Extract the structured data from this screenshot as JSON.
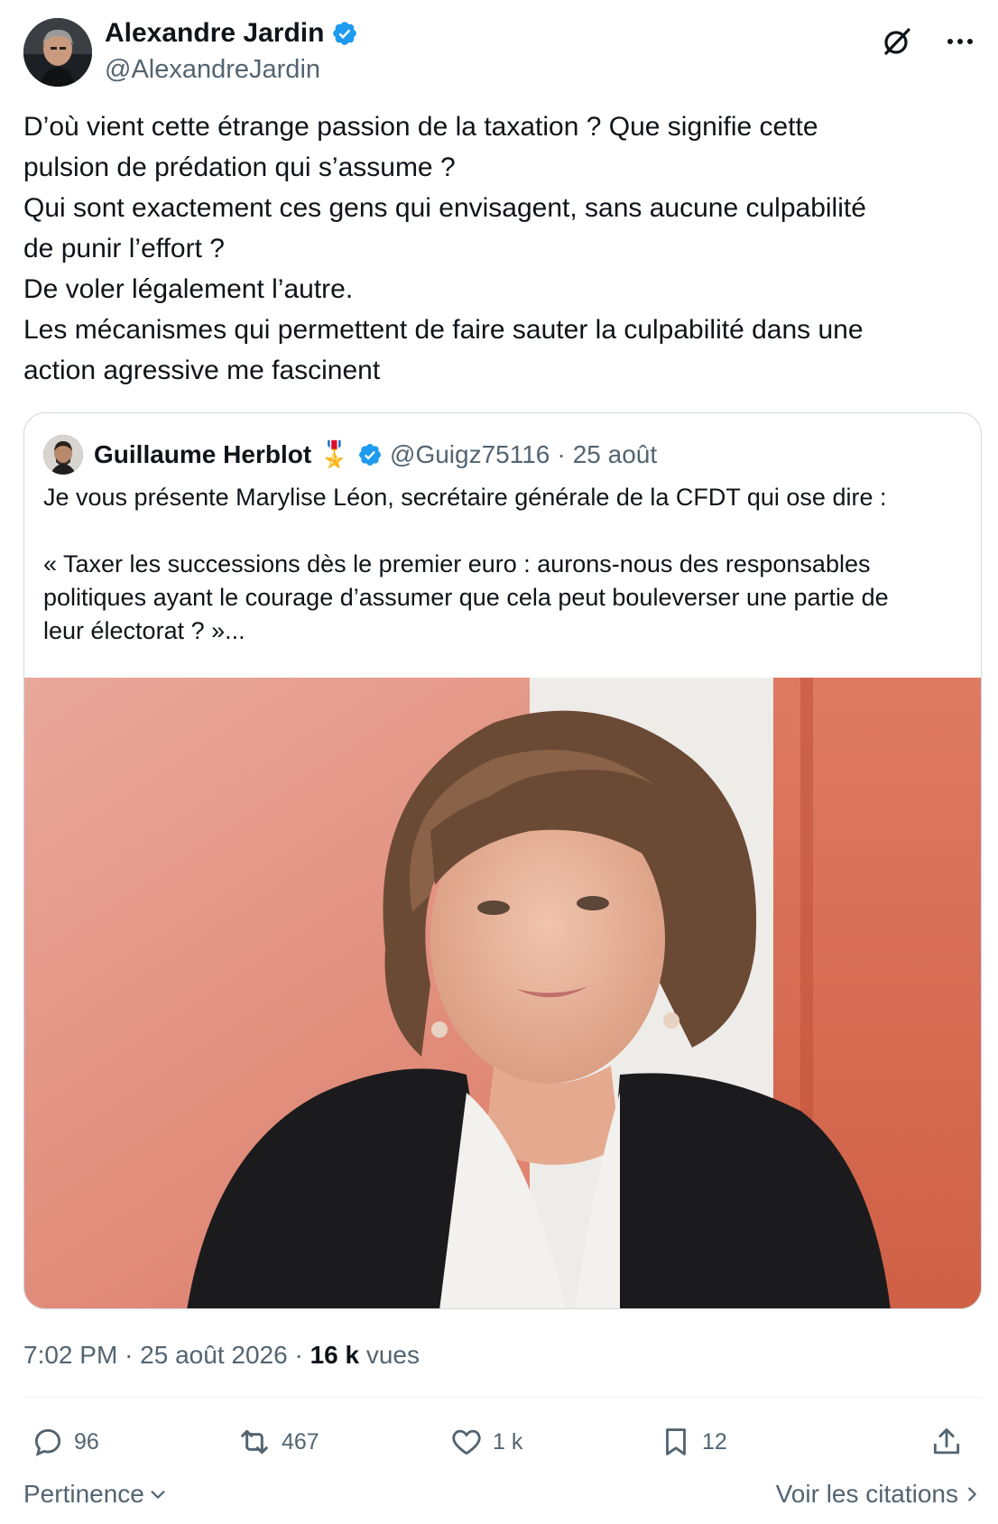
{
  "author": {
    "display_name": "Alexandre Jardin",
    "handle": "@AlexandreJardin"
  },
  "tweet": {
    "text": "D’où vient cette étrange passion de la taxation ? Que signifie cette\npulsion de prédation qui s’assume ?\nQui sont exactement ces gens qui envisagent, sans aucune culpabilité\nde punir l’effort ?\nDe voler légalement l’autre.\nLes mécanismes qui permettent de faire sauter la culpabilité dans une\naction agressive me fascinent",
    "time": "7:02 PM",
    "date": "25 août 2026",
    "views_count": "16 k",
    "views_label": "vues"
  },
  "quoted": {
    "display_name": "Guillaume Herblot",
    "badge_emoji": "🎖️",
    "handle": "@Guigz75116",
    "separator": "·",
    "date": "25 août",
    "text": "Je vous présente Marylise Léon, secrétaire générale de la CFDT qui ose dire :\n\n« Taxer les successions dès le premier euro : aurons-nous des responsables\npolitiques ayant le courage d’assumer que cela peut bouleverser une partie de\nleur électorat ? »..."
  },
  "actions": {
    "replies": "96",
    "reposts": "467",
    "likes": "1 k",
    "bookmarks": "12"
  },
  "footer": {
    "sort_label": "Pertinence",
    "quotes_label": "Voir les citations"
  },
  "icons": {
    "verified": "verified-badge-icon",
    "grok": "grok-icon",
    "more": "more-icon",
    "reply": "reply-icon",
    "repost": "repost-icon",
    "like": "heart-icon",
    "bookmark": "bookmark-icon",
    "share": "share-icon"
  },
  "colors": {
    "verified_blue": "#1d9bf0",
    "text_primary": "#0f1419",
    "text_secondary": "#536471",
    "border": "#cfd9de"
  }
}
